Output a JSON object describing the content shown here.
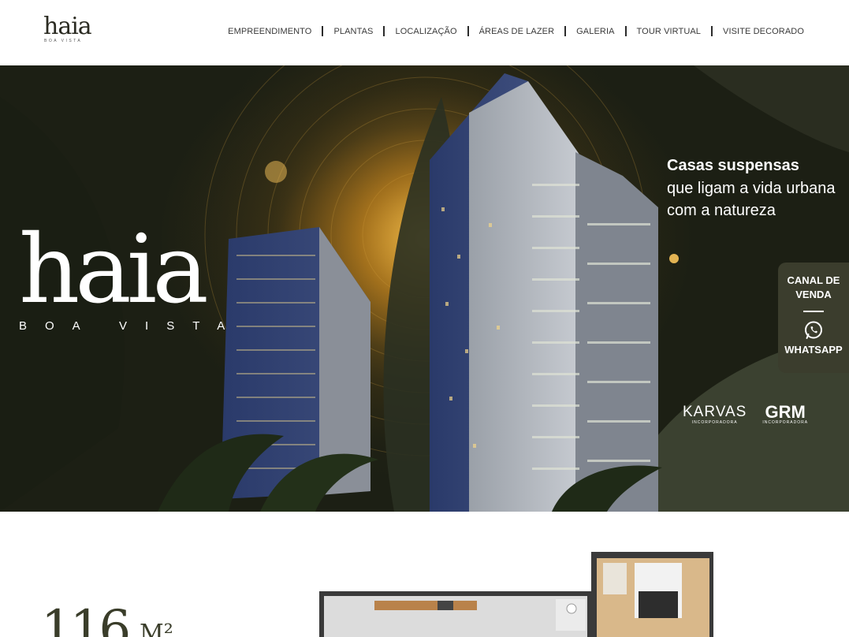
{
  "header": {
    "logo": {
      "word": "haia",
      "sub": "BOA VISTA"
    },
    "nav": [
      {
        "label": "EMPREENDIMENTO"
      },
      {
        "label": "PLANTAS"
      },
      {
        "label": "LOCALIZAÇÃO"
      },
      {
        "label": "ÁREAS DE LAZER"
      },
      {
        "label": "GALERIA"
      },
      {
        "label": "TOUR VIRTUAL"
      },
      {
        "label": "VISITE DECORADO"
      }
    ]
  },
  "hero": {
    "logo": {
      "word": "haia",
      "sub": "BOA VISTA"
    },
    "tagline_strong": "Casas suspensas",
    "tagline_rest": "que ligam a vida urbana com a natureza",
    "partners": [
      {
        "name": "KARVAS",
        "sub": "INCORPORADORA"
      },
      {
        "name": "GRM",
        "sub": "INCORPORADORA"
      }
    ]
  },
  "whatsapp": {
    "title": "CANAL DE VENDA",
    "label": "WHATSAPP",
    "icon": "whatsapp-icon"
  },
  "plans": {
    "area_number": "116",
    "area_unit": "M²"
  },
  "colors": {
    "dark_olive": "#3b3d2d",
    "gold_glow": "#b07a1f",
    "text_dark": "#3a3a3a"
  }
}
